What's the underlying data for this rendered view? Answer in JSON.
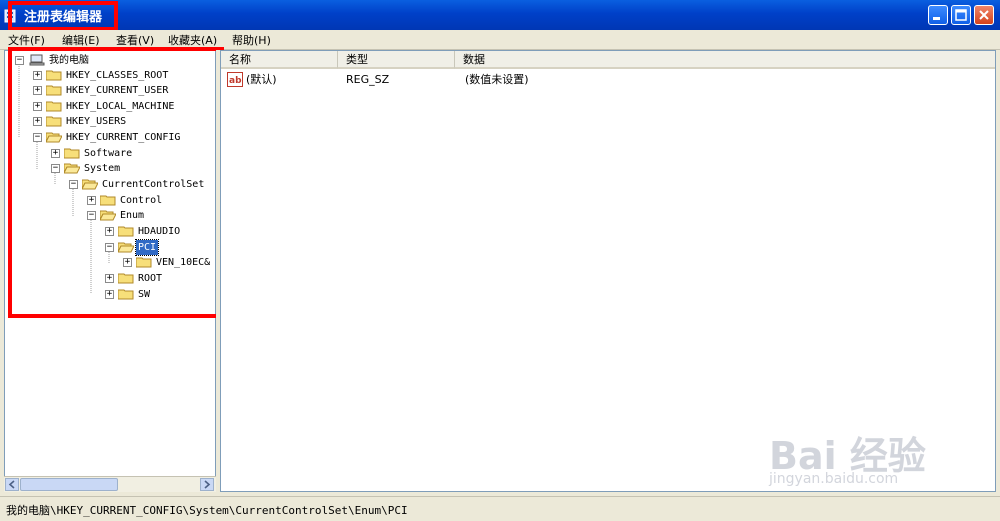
{
  "window": {
    "title": "注册表编辑器"
  },
  "menu": {
    "items": [
      "文件(F)",
      "编辑(E)",
      "查看(V)",
      "收藏夹(A)",
      "帮助(H)"
    ]
  },
  "tree": {
    "root": "我的电脑",
    "nodes": {
      "classes_root": "HKEY_CLASSES_ROOT",
      "current_user": "HKEY_CURRENT_USER",
      "local_machine": "HKEY_LOCAL_MACHINE",
      "users": "HKEY_USERS",
      "current_config": "HKEY_CURRENT_CONFIG",
      "software": "Software",
      "system": "System",
      "current_control_set": "CurrentControlSet",
      "control": "Control",
      "enum": "Enum",
      "hdaudio": "HDAUDIO",
      "pci": "PCI",
      "ven": "VEN_10EC&",
      "root_key": "ROOT",
      "sw": "SW"
    },
    "selected": "PCI"
  },
  "list": {
    "columns": [
      "名称",
      "类型",
      "数据"
    ],
    "rows": [
      {
        "name": "(默认)",
        "type": "REG_SZ",
        "data": "(数值未设置)"
      }
    ]
  },
  "status": {
    "path": "我的电脑\\HKEY_CURRENT_CONFIG\\System\\CurrentControlSet\\Enum\\PCI"
  },
  "watermark": {
    "brand": "Bai 经验",
    "url": "jingyan.baidu.com"
  },
  "colors": {
    "titlebar": "#0a5fe0",
    "selection": "#316ac5",
    "highlight": "#ff0000"
  }
}
